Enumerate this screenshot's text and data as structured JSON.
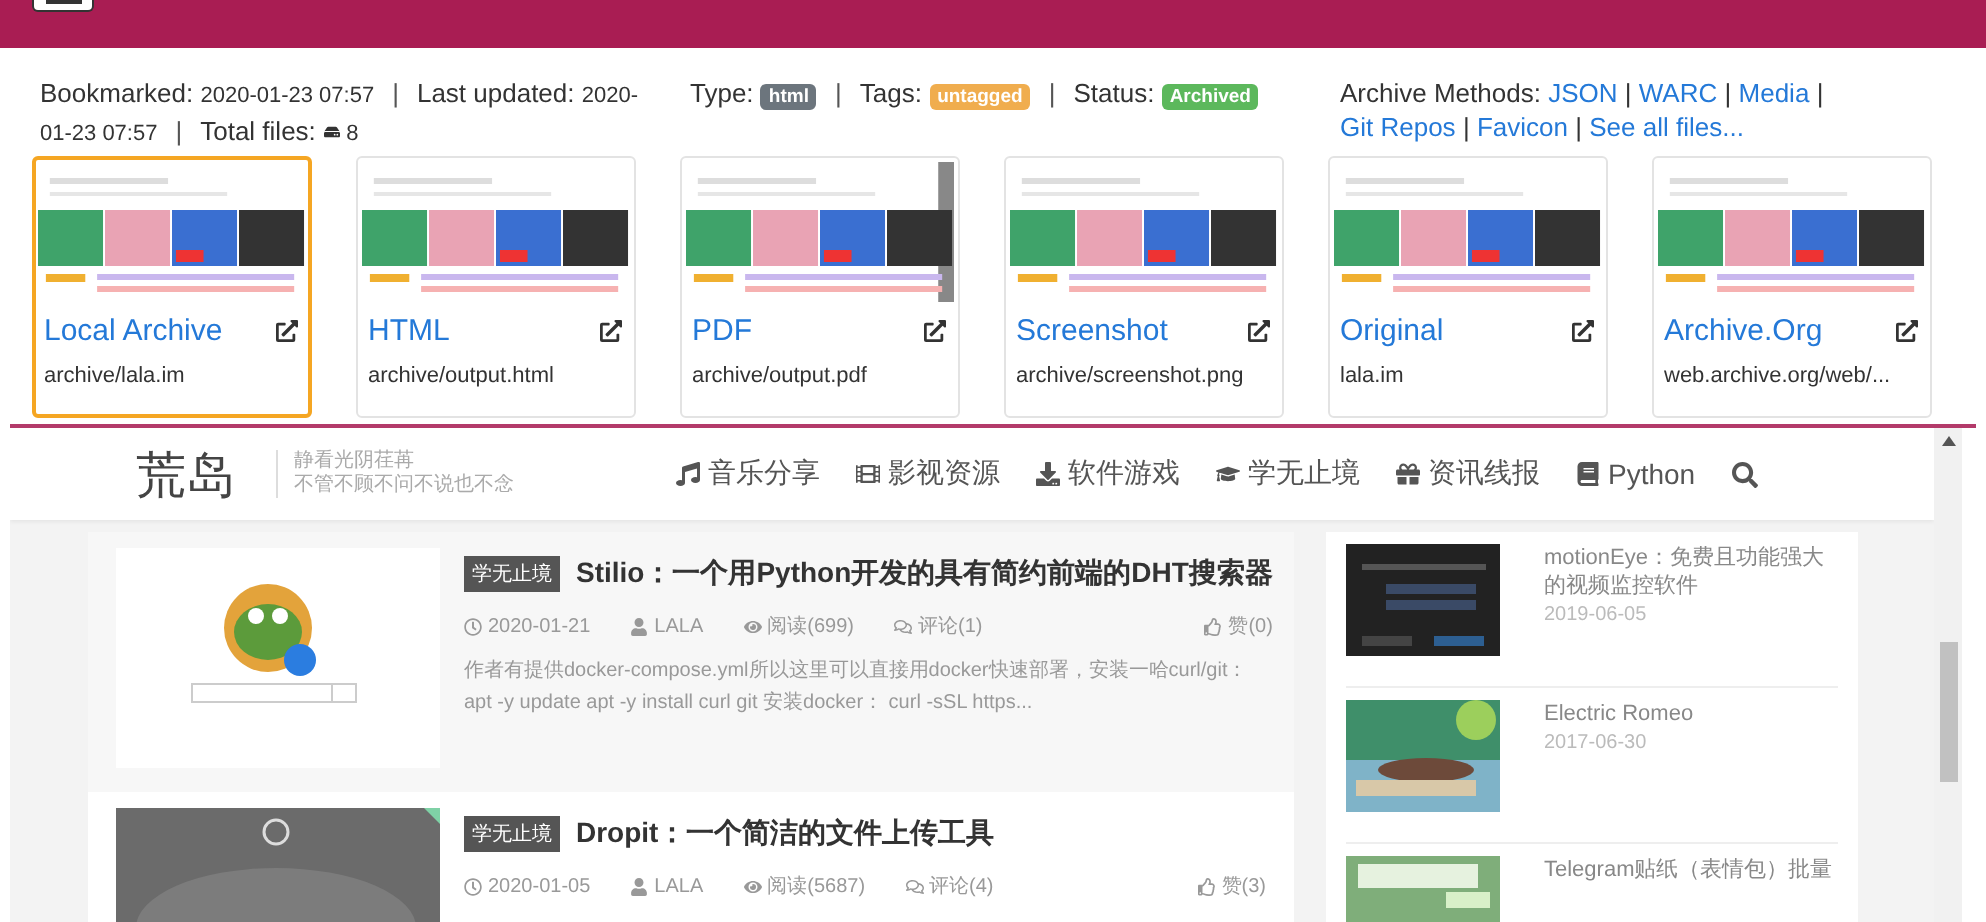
{
  "info": {
    "separator": "|",
    "bookmarked_label": "Bookmarked:",
    "bookmarked": "2020-01-23 07:57",
    "updated_label": "Last updated:",
    "updated": [
      "2020-",
      "01-23 07:57"
    ],
    "files_label": "Total files:",
    "files": "8",
    "type_label": "Type:",
    "type": "html",
    "tags_label": "Tags:",
    "tags": "untagged",
    "status_label": "Status:",
    "status": "Archived",
    "methods_label": "Archive Methods:",
    "methods": [
      "JSON",
      "WARC",
      "Media",
      "Git Repos",
      "Favicon",
      "See all files..."
    ]
  },
  "cards": [
    {
      "title": "Local Archive",
      "path": "archive/lala.im",
      "selected": true
    },
    {
      "title": "HTML",
      "path": "archive/output.html",
      "selected": false
    },
    {
      "title": "PDF",
      "path": "archive/output.pdf",
      "selected": false
    },
    {
      "title": "Screenshot",
      "path": "archive/screenshot.png",
      "selected": false
    },
    {
      "title": "Original",
      "path": "lala.im",
      "selected": false
    },
    {
      "title": "Archive.Org",
      "path": "web.archive.org/web/...",
      "selected": false
    }
  ],
  "site": {
    "logo": "荒岛",
    "tagline": [
      "静看光阴荏苒",
      "不管不顾不问不说也不念"
    ],
    "nav": [
      "音乐分享",
      "影视资源",
      "软件游戏",
      "学无止境",
      "资讯线报",
      "Python"
    ],
    "posts": [
      {
        "category": "学无止境",
        "title": "Stilio：一个用Python开发的具有简约前端的DHT搜索器",
        "date": "2020-01-21",
        "author": "LALA",
        "views": "阅读(699)",
        "comments": "评论(1)",
        "likes": "赞(0)",
        "excerpt": "作者有提供docker-compose.yml所以这里可以直接用docker快速部署，安装一哈curl/git： apt -y update apt -y install curl git 安装docker： curl -sSL https..."
      },
      {
        "category": "学无止境",
        "title": "Dropit：一个简洁的文件上传工具",
        "date": "2020-01-05",
        "author": "LALA",
        "views": "阅读(5687)",
        "comments": "评论(4)",
        "likes": "赞(3)"
      }
    ],
    "sidebar": [
      {
        "title": "motionEye：免费且功能强大的视频监控软件",
        "date": "2019-06-05"
      },
      {
        "title": "Electric Romeo",
        "date": "2017-06-30"
      },
      {
        "title": "Telegram贴纸（表情包）批量"
      }
    ]
  }
}
